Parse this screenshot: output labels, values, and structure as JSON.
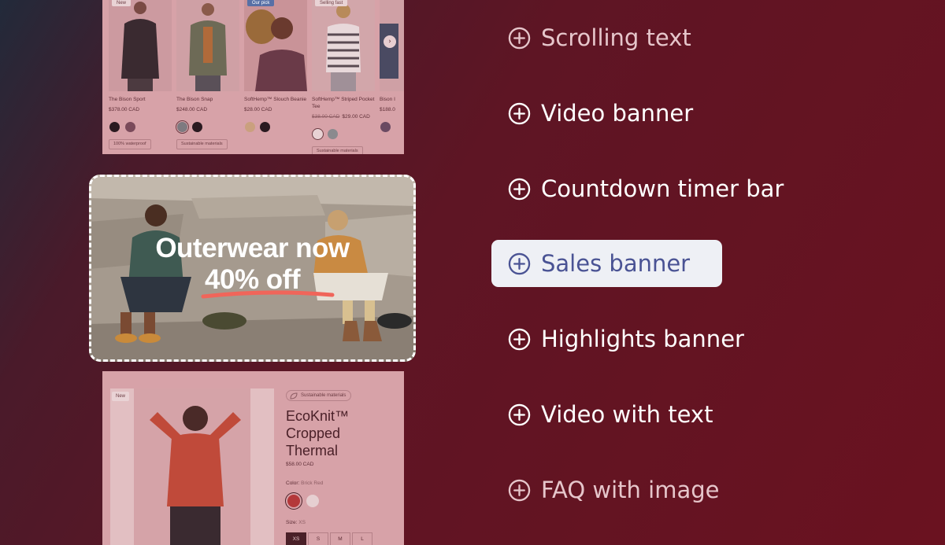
{
  "preview": {
    "products": [
      {
        "badge": "New",
        "name": "The Bison Sport",
        "price": "$378.00 CAD",
        "tag": "100% waterproof"
      },
      {
        "badge": "",
        "name": "The Bison Snap",
        "price": "$248.00 CAD",
        "tag": "Sustainable materials"
      },
      {
        "badge": "Our pick",
        "name": "SoftHemp™ Slouch Beanie",
        "price": "$28.00 CAD",
        "tag": ""
      },
      {
        "badge": "Selling fast",
        "name": "SoftHemp™ Striped Pocket Tee",
        "old_price": "$38.00 CAD",
        "price": "$29.00 CAD",
        "tag": "Sustainable materials"
      },
      {
        "badge": "",
        "name": "Bison I",
        "price": "$188.0",
        "tag": ""
      }
    ],
    "carousel_next": "›",
    "banner": {
      "line1": "Outerwear now",
      "line2": "40% off"
    },
    "product_detail": {
      "badge": "New",
      "tag": "Sustainable materials",
      "title": "EcoKnit™ Cropped Thermal",
      "price": "$58.00 CAD",
      "color_label": "Color:",
      "color_value": "Brick Red",
      "size_label": "Size:",
      "size_value": "XS",
      "sizes": [
        "XS",
        "S",
        "M",
        "L"
      ]
    },
    "colors": {
      "brick_red": "#b4383a",
      "black": "#2a1a20",
      "grey": "#7e7a80",
      "tan": "#caa07e"
    }
  },
  "menu": {
    "items": [
      {
        "label": "Scrolling text",
        "icon": "plus-circle-icon"
      },
      {
        "label": "Video banner",
        "icon": "plus-circle-icon"
      },
      {
        "label": "Countdown timer bar",
        "icon": "plus-circle-icon"
      },
      {
        "label": "Sales banner",
        "icon": "plus-circle-icon",
        "active": true
      },
      {
        "label": "Highlights banner",
        "icon": "plus-circle-icon"
      },
      {
        "label": "Video with text",
        "icon": "plus-circle-icon"
      },
      {
        "label": "FAQ with image",
        "icon": "plus-circle-icon"
      }
    ],
    "active_bg": "#eef0f5",
    "active_color": "#4a5394"
  }
}
